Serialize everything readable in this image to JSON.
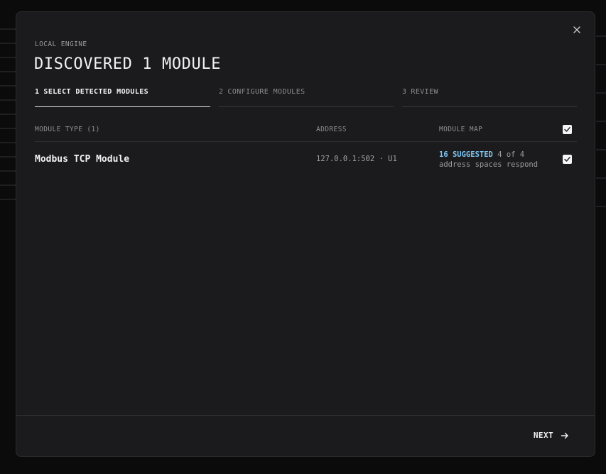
{
  "header": {
    "eyebrow": "LOCAL ENGINE",
    "title": "DISCOVERED 1 MODULE"
  },
  "steps": [
    {
      "num": "1",
      "label": "SELECT DETECTED MODULES",
      "active": true
    },
    {
      "num": "2",
      "label": "CONFIGURE MODULES",
      "active": false
    },
    {
      "num": "3",
      "label": "REVIEW",
      "active": false
    }
  ],
  "table": {
    "columns": {
      "module_type": "MODULE TYPE (1)",
      "address": "ADDRESS",
      "module_map": "MODULE MAP"
    },
    "select_all_checked": true,
    "rows": [
      {
        "name": "Modbus TCP Module",
        "address": "127.0.0.1:502 · U1",
        "suggested": "16 SUGGESTED",
        "map_count": "4 of 4",
        "map_detail": "address spaces respond",
        "checked": true
      }
    ]
  },
  "footer": {
    "next_label": "NEXT"
  },
  "colors": {
    "accent": "#7cc4f0",
    "modal_bg": "#1b1b1d",
    "page_bg": "#0b0b0c"
  },
  "icons": {
    "close": "close-icon",
    "next": "arrow-right-icon",
    "check": "checkmark-icon"
  }
}
